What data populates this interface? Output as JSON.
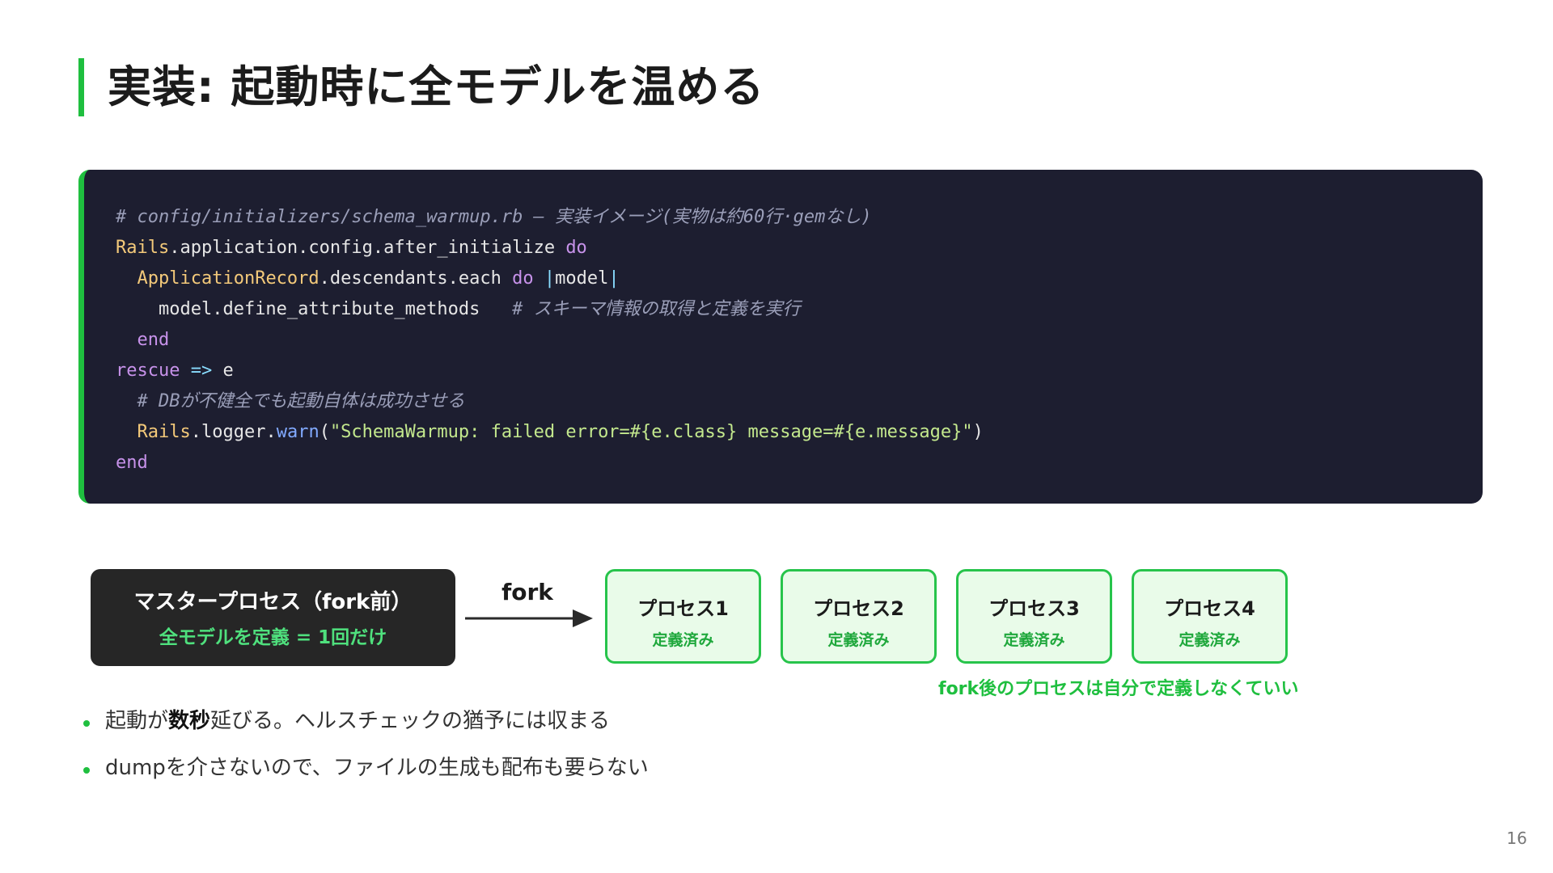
{
  "slide": {
    "title": "実装: 起動時に全モデルを温める",
    "page_number": "16"
  },
  "code": {
    "line1_comment": "# config/initializers/schema_warmup.rb — 実装イメージ(実物は約60行·gemなし)",
    "line2": {
      "const": "Rails",
      "text": ".application.config.after_initialize ",
      "kw": "do"
    },
    "line3": {
      "indent": "  ",
      "const": "ApplicationRecord",
      "text": ".descendants.each ",
      "kw": "do",
      "pipe_open": " |",
      "param": "model",
      "pipe_close": "|"
    },
    "line4": {
      "indent": "    ",
      "text": "model.define_attribute_methods   ",
      "comment": "# スキーマ情報の取得と定義を実行"
    },
    "line5": {
      "indent": "  ",
      "kw": "end"
    },
    "line6": {
      "kw": "rescue",
      "op": " => ",
      "var": "e"
    },
    "line7": {
      "indent": "  ",
      "comment": "# DBが不健全でも起動自体は成功させる"
    },
    "line8": {
      "indent": "  ",
      "const": "Rails",
      "text": ".logger.",
      "fn": "warn",
      "paren_open": "(",
      "str": "\"SchemaWarmup: failed error=#{e.class} message=#{e.message}\"",
      "paren_close": ")"
    },
    "line9": {
      "kw": "end"
    }
  },
  "diagram": {
    "master_title": "マスタープロセス（fork前）",
    "master_sub": "全モデルを定義 = 1回だけ",
    "fork_label": "fork",
    "processes": [
      {
        "name": "プロセス1",
        "status": "定義済み"
      },
      {
        "name": "プロセス2",
        "status": "定義済み"
      },
      {
        "name": "プロセス3",
        "status": "定義済み"
      },
      {
        "name": "プロセス4",
        "status": "定義済み"
      }
    ],
    "note": "fork後のプロセスは自分で定義しなくていい"
  },
  "bullets": [
    {
      "pre": "起動が",
      "bold": "数秒",
      "post": "延びる。ヘルスチェックの猶予には収まる"
    },
    {
      "text": "dumpを介さないので、ファイルの生成も配布も要らない"
    }
  ],
  "colors": {
    "accent": "#1fbf3f",
    "code_bg": "#1d1e30",
    "master_bg": "#262626",
    "process_bg": "#e9fbe9"
  }
}
